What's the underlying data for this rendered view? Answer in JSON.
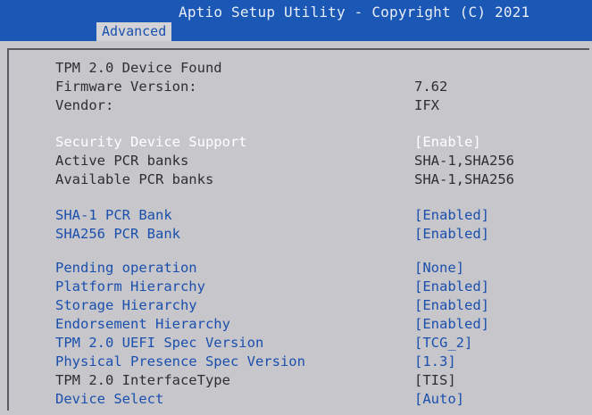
{
  "header": {
    "title": "Aptio Setup Utility - Copyright (C) 2021",
    "tab": "Advanced"
  },
  "rows": [
    {
      "label": "TPM 2.0 Device Found",
      "value": ""
    },
    {
      "label": "Firmware Version:",
      "value": "7.62"
    },
    {
      "label": "Vendor:",
      "value": "IFX"
    },
    {
      "label": "Security Device Support",
      "value": "[Enable]"
    },
    {
      "label": "Active PCR banks",
      "value": "SHA-1,SHA256"
    },
    {
      "label": "Available PCR banks",
      "value": "SHA-1,SHA256"
    },
    {
      "label": "SHA-1 PCR Bank",
      "value": "[Enabled]"
    },
    {
      "label": "SHA256 PCR Bank",
      "value": "[Enabled]"
    },
    {
      "label": "Pending operation",
      "value": "[None]"
    },
    {
      "label": "Platform Hierarchy",
      "value": "[Enabled]"
    },
    {
      "label": "Storage Hierarchy",
      "value": "[Enabled]"
    },
    {
      "label": "Endorsement Hierarchy",
      "value": "[Enabled]"
    },
    {
      "label": "TPM 2.0 UEFI Spec Version",
      "value": "[TCG_2]"
    },
    {
      "label": "Physical Presence Spec Version",
      "value": "[1.3]"
    },
    {
      "label": "TPM 2.0 InterfaceType",
      "value": "[TIS]"
    },
    {
      "label": "Device Select",
      "value": "[Auto]"
    }
  ]
}
